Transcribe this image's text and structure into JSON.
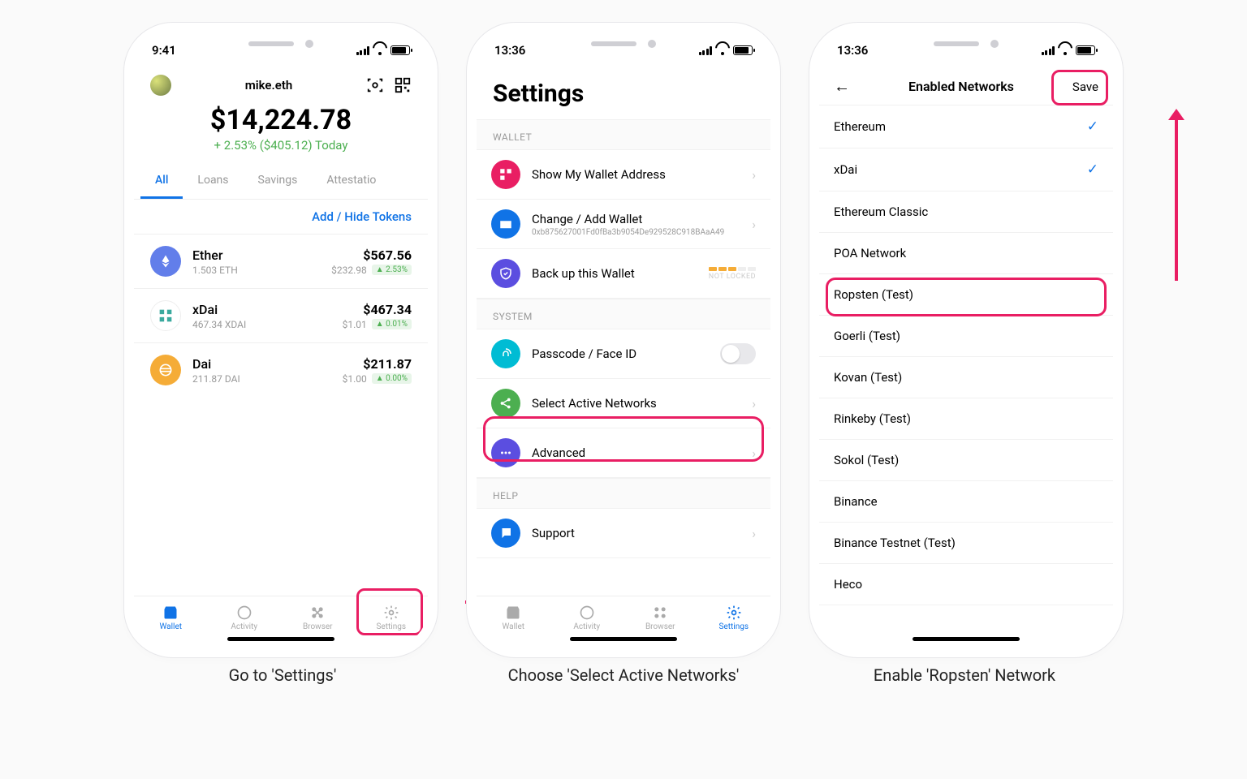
{
  "captions": {
    "step1": "Go to 'Settings'",
    "step2": "Choose 'Select Active Networks'",
    "step3": "Enable 'Ropsten' Network"
  },
  "phone1": {
    "time": "9:41",
    "wallet_name": "mike.eth",
    "balance": "$14,224.78",
    "change": "+ 2.53% ($405.12) Today",
    "tabs": {
      "all": "All",
      "loans": "Loans",
      "savings": "Savings",
      "attest": "Attestatio"
    },
    "add_hide": "Add / Hide Tokens",
    "tokens": [
      {
        "name": "Ether",
        "sub": "1.503 ETH",
        "value": "$567.56",
        "price": "$232.98",
        "pct": "2.53%"
      },
      {
        "name": "xDai",
        "sub": "467.34 XDAI",
        "value": "$467.34",
        "price": "$1.01",
        "pct": "0.01%"
      },
      {
        "name": "Dai",
        "sub": "211.87 DAI",
        "value": "$211.87",
        "price": "$1.00",
        "pct": "0.00%"
      }
    ],
    "tabbar": {
      "wallet": "Wallet",
      "activity": "Activity",
      "browser": "Browser",
      "settings": "Settings"
    }
  },
  "phone2": {
    "time": "13:36",
    "title": "Settings",
    "sect_wallet": "WALLET",
    "sect_system": "SYSTEM",
    "sect_help": "HELP",
    "rows": {
      "show_addr": "Show My Wallet Address",
      "change_wallet": "Change / Add Wallet",
      "change_wallet_sub": "0xb875627001Fd0fBa3b9054De929528C918BAaA49",
      "backup": "Back up this Wallet",
      "not_locked": "NOT LOCKED",
      "passcode": "Passcode / Face ID",
      "select_net": "Select Active Networks",
      "advanced": "Advanced",
      "support": "Support"
    },
    "tabbar": {
      "wallet": "Wallet",
      "activity": "Activity",
      "browser": "Browser",
      "settings": "Settings"
    }
  },
  "phone3": {
    "time": "13:36",
    "title": "Enabled Networks",
    "save": "Save",
    "networks": [
      {
        "name": "Ethereum",
        "checked": true
      },
      {
        "name": "xDai",
        "checked": true
      },
      {
        "name": "Ethereum Classic",
        "checked": false
      },
      {
        "name": "POA Network",
        "checked": false
      },
      {
        "name": "Ropsten (Test)",
        "checked": false
      },
      {
        "name": "Goerli (Test)",
        "checked": false
      },
      {
        "name": "Kovan (Test)",
        "checked": false
      },
      {
        "name": "Rinkeby (Test)",
        "checked": false
      },
      {
        "name": "Sokol (Test)",
        "checked": false
      },
      {
        "name": "Binance",
        "checked": false
      },
      {
        "name": "Binance Testnet (Test)",
        "checked": false
      },
      {
        "name": "Heco",
        "checked": false
      }
    ]
  }
}
